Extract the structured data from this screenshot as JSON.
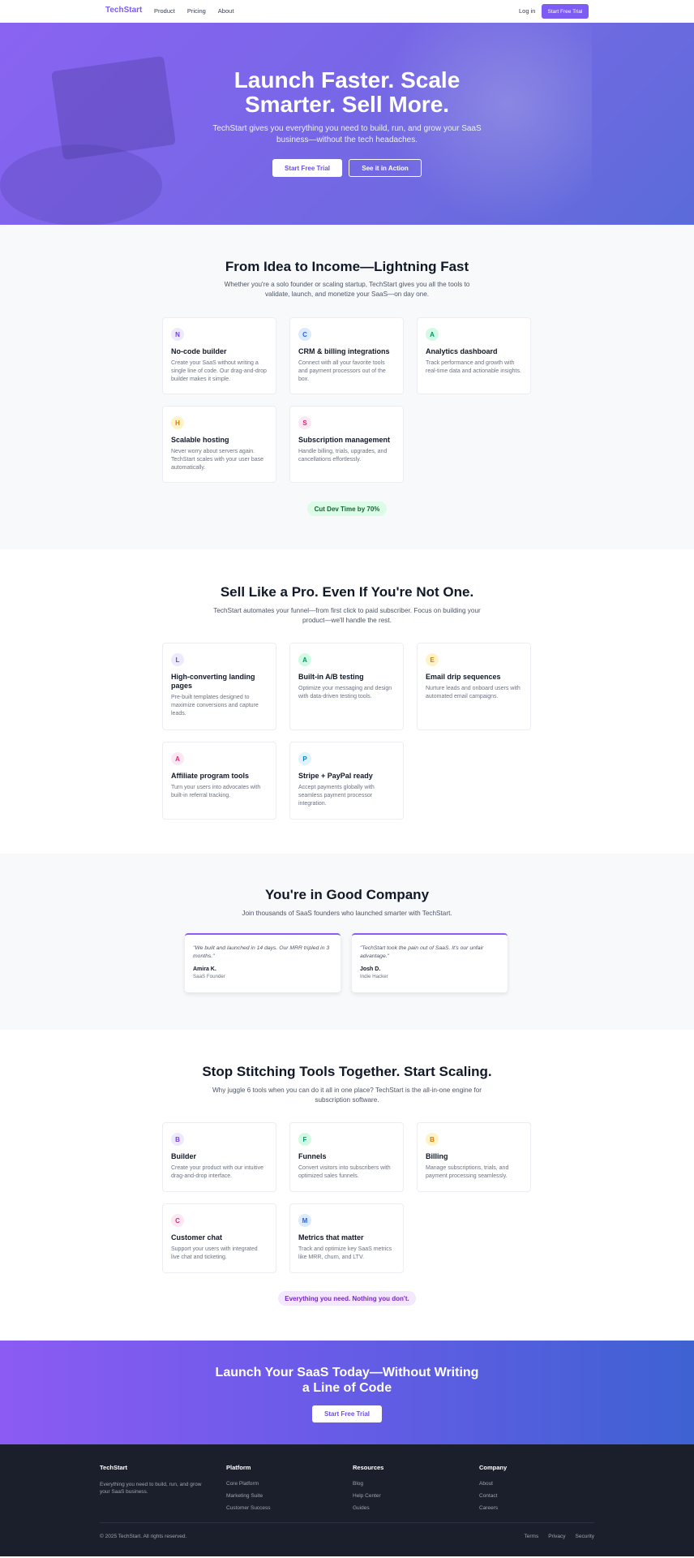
{
  "nav": {
    "brand": "TechStart",
    "links": [
      "Product",
      "Pricing",
      "About"
    ],
    "login": "Log in",
    "cta": "Start Free Trial"
  },
  "hero": {
    "title_line1": "Launch Faster. Scale",
    "title_line2": "Smarter. Sell More.",
    "subtitle": "TechStart gives you everything you need to build, run, and grow your SaaS business—without the tech headaches.",
    "primary_button": "Start Free Trial",
    "secondary_button": "See it in Action"
  },
  "features1": {
    "title": "From Idea to Income—Lightning Fast",
    "subtitle": "Whether you're a solo founder or scaling startup, TechStart gives you all the tools to validate, launch, and monetize your SaaS—on day one.",
    "cards": [
      {
        "letter": "N",
        "title": "No-code builder",
        "text": "Create your SaaS without writing a single line of code. Our drag-and-drop builder makes it simple."
      },
      {
        "letter": "C",
        "title": "CRM & billing integrations",
        "text": "Connect with all your favorite tools and payment processors out of the box."
      },
      {
        "letter": "A",
        "title": "Analytics dashboard",
        "text": "Track performance and growth with real-time data and actionable insights."
      },
      {
        "letter": "H",
        "title": "Scalable hosting",
        "text": "Never worry about servers again. TechStart scales with your user base automatically."
      },
      {
        "letter": "S",
        "title": "Subscription management",
        "text": "Handle billing, trials, upgrades, and cancellations effortlessly."
      }
    ],
    "badge": "Cut Dev Time by 70%"
  },
  "features2": {
    "title": "Sell Like a Pro. Even If You're Not One.",
    "subtitle": "TechStart automates your funnel—from first click to paid subscriber. Focus on building your product—we'll handle the rest.",
    "cards": [
      {
        "letter": "L",
        "title": "High-converting landing pages",
        "text": "Pre-built templates designed to maximize conversions and capture leads."
      },
      {
        "letter": "A",
        "title": "Built-in A/B testing",
        "text": "Optimize your messaging and design with data-driven testing tools."
      },
      {
        "letter": "E",
        "title": "Email drip sequences",
        "text": "Nurture leads and onboard users with automated email campaigns."
      },
      {
        "letter": "A",
        "title": "Affiliate program tools",
        "text": "Turn your users into advocates with built-in referral tracking."
      },
      {
        "letter": "P",
        "title": "Stripe + PayPal ready",
        "text": "Accept payments globally with seamless payment processor integration."
      }
    ]
  },
  "testimonials": {
    "title": "You're in Good Company",
    "subtitle": "Join thousands of SaaS founders who launched smarter with TechStart.",
    "items": [
      {
        "quote": "\"We built and launched in 14 days. Our MRR tripled in 3 months.\"",
        "name": "Amira K.",
        "role": "SaaS Founder"
      },
      {
        "quote": "\"TechStart took the pain out of SaaS. It's our unfair advantage.\"",
        "name": "Josh D.",
        "role": "Indie Hacker"
      }
    ]
  },
  "features3": {
    "title": "Stop Stitching Tools Together. Start Scaling.",
    "subtitle": "Why juggle 6 tools when you can do it all in one place? TechStart is the all-in-one engine for subscription software.",
    "cards": [
      {
        "letter": "B",
        "title": "Builder",
        "text": "Create your product with our intuitive drag-and-drop interface."
      },
      {
        "letter": "F",
        "title": "Funnels",
        "text": "Convert visitors into subscribers with optimized sales funnels."
      },
      {
        "letter": "B",
        "title": "Billing",
        "text": "Manage subscriptions, trials, and payment processing seamlessly."
      },
      {
        "letter": "C",
        "title": "Customer chat",
        "text": "Support your users with integrated live chat and ticketing."
      },
      {
        "letter": "M",
        "title": "Metrics that matter",
        "text": "Track and optimize key SaaS metrics like MRR, churn, and LTV."
      }
    ],
    "badge": "Everything you need. Nothing you don't."
  },
  "cta": {
    "title_line1": "Launch Your SaaS Today—Without Writing",
    "title_line2": "a Line of Code",
    "button": "Start Free Trial"
  },
  "footer": {
    "brand": "TechStart",
    "description": "Everything you need to build, run, and grow your SaaS business.",
    "platform": {
      "heading": "Platform",
      "links": [
        "Core Platform",
        "Marketing Suite",
        "Customer Success"
      ]
    },
    "resources": {
      "heading": "Resources",
      "links": [
        "Blog",
        "Help Center",
        "Guides"
      ]
    },
    "company": {
      "heading": "Company",
      "links": [
        "About",
        "Contact",
        "Careers"
      ]
    },
    "copyright": "© 2025 TechStart. All rights reserved.",
    "legal": [
      "Terms",
      "Privacy",
      "Security"
    ]
  },
  "colors": {
    "accent": "#7c5cf5",
    "icon_bg": [
      "#ede9fe",
      "#dbeafe",
      "#d1fae5",
      "#fef3c7",
      "#fce7f3",
      "#e0f2fe"
    ],
    "icon_fg": [
      "#7c3aed",
      "#2563eb",
      "#059669",
      "#d97706",
      "#db2777",
      "#0284c7"
    ],
    "badge_green_bg": "#dcfce7",
    "badge_green_fg": "#166534",
    "badge_purple_bg": "#f3e8ff",
    "badge_purple_fg": "#7e22ce"
  }
}
